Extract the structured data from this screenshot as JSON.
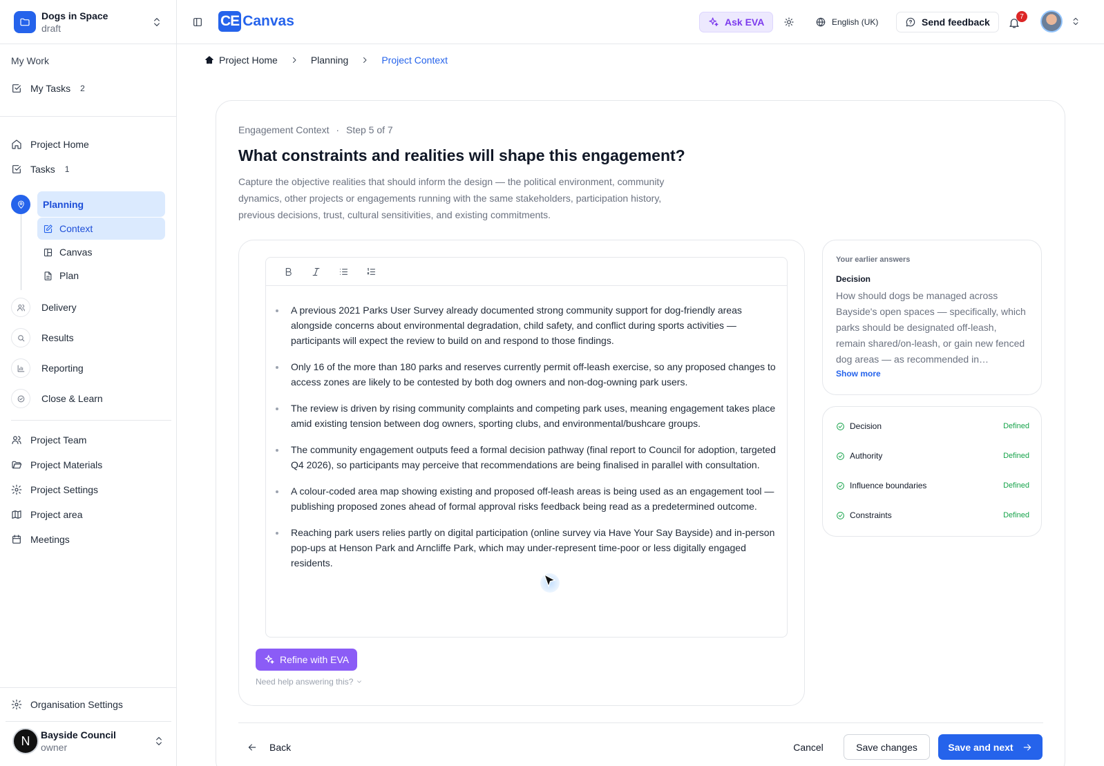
{
  "project": {
    "name": "Dogs in Space",
    "status": "draft"
  },
  "sidebar": {
    "my_work_title": "My Work",
    "my_tasks": {
      "label": "My Tasks",
      "count": "2"
    },
    "project_home": "Project Home",
    "tasks": {
      "label": "Tasks",
      "count": "1"
    },
    "phases": {
      "planning": "Planning",
      "planning_items": {
        "context": "Context",
        "canvas": "Canvas",
        "plan": "Plan"
      },
      "delivery": "Delivery",
      "results": "Results",
      "reporting": "Reporting",
      "close_learn": "Close & Learn"
    },
    "links": {
      "team": "Project Team",
      "materials": "Project Materials",
      "settings": "Project Settings",
      "area": "Project area",
      "meetings": "Meetings"
    },
    "org_settings": "Organisation Settings",
    "org": {
      "initial": "N",
      "name": "Bayside Council",
      "role": "owner"
    }
  },
  "topbar": {
    "logo_mark": "CE",
    "logo_text": "Canvas",
    "ask_eva": "Ask EVA",
    "language": "English (UK)",
    "feedback": "Send feedback",
    "notifications": "7"
  },
  "breadcrumb": {
    "home": "Project Home",
    "planning": "Planning",
    "current": "Project Context"
  },
  "question": {
    "section": "Engagement Context",
    "sep": "·",
    "step": "Step 5 of 7",
    "title": "What constraints and realities will shape this engagement?",
    "description": "Capture the objective realities that should inform the design — the political environment, community dynamics, other projects or engagements running with the same stakeholders, participation history, previous decisions, trust, cultural sensitivities, and existing commitments."
  },
  "editor": {
    "bullets": [
      "A previous 2021 Parks User Survey already documented strong community support for dog-friendly areas alongside concerns about environmental degradation, child safety, and conflict during sports activities — participants will expect the review to build on and respond to those findings.",
      "Only 16 of the more than 180 parks and reserves currently permit off-leash exercise, so any proposed changes to access zones are likely to be contested by both dog owners and non-dog-owning park users.",
      "The review is driven by rising community complaints and competing park uses, meaning engagement takes place amid existing tension between dog owners, sporting clubs, and environmental/bushcare groups.",
      "The community engagement outputs feed a formal decision pathway (final report to Council for adoption, targeted Q4 2026), so participants may perceive that recommendations are being finalised in parallel with consultation.",
      "A colour-coded area map showing existing and proposed off-leash areas is being used as an engagement tool — publishing proposed zones ahead of formal approval risks feedback being read as a predetermined outcome.",
      "Reaching park users relies partly on digital participation (online survey via Have Your Say Bayside) and in-person pop-ups at Henson Park and Arncliffe Park, which may under-represent time-poor or less digitally engaged residents."
    ]
  },
  "refine": {
    "label": "Refine with EVA",
    "help": "Need help answering this?"
  },
  "earlier": {
    "heading": "Your earlier answers",
    "title": "Decision",
    "body": "How should dogs be managed across Bayside's open spaces — specifically, which parks should be designated off-leash, remain shared/on-leash, or gain new fenced dog areas — as recommended in…",
    "show_more": "Show more"
  },
  "status_list": [
    {
      "label": "Decision",
      "status": "Defined"
    },
    {
      "label": "Authority",
      "status": "Defined"
    },
    {
      "label": "Influence boundaries",
      "status": "Defined"
    },
    {
      "label": "Constraints",
      "status": "Defined"
    }
  ],
  "footer": {
    "back": "Back",
    "cancel": "Cancel",
    "save": "Save changes",
    "next": "Save and next"
  },
  "colors": {
    "primary": "#2563eb",
    "eva": "#8b5cf6",
    "success": "#16a34a"
  }
}
